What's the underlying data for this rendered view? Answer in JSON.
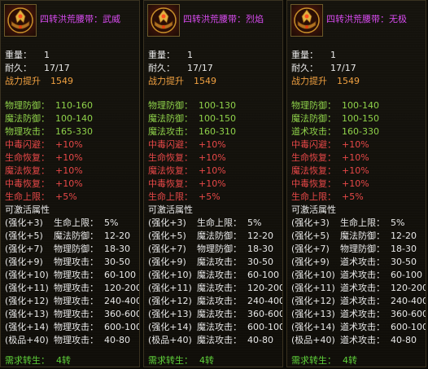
{
  "items": [
    {
      "name": "四转洪荒腰带：武威",
      "weight_label": "重量：",
      "weight": "1",
      "durability_label": "耐久：",
      "durability": "17/17",
      "power_label": "战力提升",
      "power": "1549",
      "attributes": [
        {
          "label": "物理防御：",
          "value": "110-160"
        },
        {
          "label": "魔法防御：",
          "value": "100-140"
        },
        {
          "label": "物理攻击：",
          "value": "165-330"
        }
      ],
      "bonuses": [
        {
          "label": "中毒闪避：",
          "value": "+10%"
        },
        {
          "label": "生命恢复：",
          "value": "+10%"
        },
        {
          "label": "魔法恢复：",
          "value": "+10%"
        },
        {
          "label": "中毒恢复：",
          "value": "+10%"
        },
        {
          "label": "生命上限：",
          "value": "+5%"
        }
      ],
      "activatable_title": "可激活属性",
      "enhancements": [
        {
          "level": "(强化+3)",
          "label": "生命上限：",
          "value": "5%"
        },
        {
          "level": "(强化+5)",
          "label": "魔法防御：",
          "value": "12-20"
        },
        {
          "level": "(强化+7)",
          "label": "物理防御：",
          "value": "18-30"
        },
        {
          "level": "(强化+9)",
          "label": "物理攻击：",
          "value": "30-50"
        },
        {
          "level": "(强化+10)",
          "label": "物理攻击：",
          "value": "60-100"
        },
        {
          "level": "(强化+11)",
          "label": "物理攻击：",
          "value": "120-200"
        },
        {
          "level": "(强化+12)",
          "label": "物理攻击：",
          "value": "240-400"
        },
        {
          "level": "(强化+13)",
          "label": "物理攻击：",
          "value": "360-600"
        },
        {
          "level": "(强化+14)",
          "label": "物理攻击：",
          "value": "600-1000"
        },
        {
          "level": "(极品+40)",
          "label": "物理攻击：",
          "value": "40-80"
        }
      ],
      "requirement_label": "需求转生：",
      "requirement": "4转"
    },
    {
      "name": "四转洪荒腰带：烈焰",
      "weight_label": "重量：",
      "weight": "1",
      "durability_label": "耐久：",
      "durability": "17/17",
      "power_label": "战力提升",
      "power": "1549",
      "attributes": [
        {
          "label": "物理防御：",
          "value": "100-130"
        },
        {
          "label": "魔法防御：",
          "value": "100-150"
        },
        {
          "label": "魔法攻击：",
          "value": "160-310"
        }
      ],
      "bonuses": [
        {
          "label": "中毒闪避：",
          "value": "+10%"
        },
        {
          "label": "生命恢复：",
          "value": "+10%"
        },
        {
          "label": "魔法恢复：",
          "value": "+10%"
        },
        {
          "label": "中毒恢复：",
          "value": "+10%"
        },
        {
          "label": "生命上限：",
          "value": "+5%"
        }
      ],
      "activatable_title": "可激活属性",
      "enhancements": [
        {
          "level": "(强化+3)",
          "label": "生命上限：",
          "value": "5%"
        },
        {
          "level": "(强化+5)",
          "label": "魔法防御：",
          "value": "12-20"
        },
        {
          "level": "(强化+7)",
          "label": "物理防御：",
          "value": "18-30"
        },
        {
          "level": "(强化+9)",
          "label": "魔法攻击：",
          "value": "30-50"
        },
        {
          "level": "(强化+10)",
          "label": "魔法攻击：",
          "value": "60-100"
        },
        {
          "level": "(强化+11)",
          "label": "魔法攻击：",
          "value": "120-200"
        },
        {
          "level": "(强化+12)",
          "label": "魔法攻击：",
          "value": "240-400"
        },
        {
          "level": "(强化+13)",
          "label": "魔法攻击：",
          "value": "360-600"
        },
        {
          "level": "(强化+14)",
          "label": "魔法攻击：",
          "value": "600-1000"
        },
        {
          "level": "(极品+40)",
          "label": "魔法攻击：",
          "value": "40-80"
        }
      ],
      "requirement_label": "需求转生：",
      "requirement": "4转"
    },
    {
      "name": "四转洪荒腰带：无极",
      "weight_label": "重量：",
      "weight": "1",
      "durability_label": "耐久：",
      "durability": "17/17",
      "power_label": "战力提升",
      "power": "1549",
      "attributes": [
        {
          "label": "物理防御：",
          "value": "100-140"
        },
        {
          "label": "魔法防御：",
          "value": "100-150"
        },
        {
          "label": "道术攻击：",
          "value": "160-330"
        }
      ],
      "bonuses": [
        {
          "label": "中毒闪避：",
          "value": "+10%"
        },
        {
          "label": "生命恢复：",
          "value": "+10%"
        },
        {
          "label": "魔法恢复：",
          "value": "+10%"
        },
        {
          "label": "中毒恢复：",
          "value": "+10%"
        },
        {
          "label": "生命上限：",
          "value": "+5%"
        }
      ],
      "activatable_title": "可激活属性",
      "enhancements": [
        {
          "level": "(强化+3)",
          "label": "生命上限：",
          "value": "5%"
        },
        {
          "level": "(强化+5)",
          "label": "魔法防御：",
          "value": "12-20"
        },
        {
          "level": "(强化+7)",
          "label": "物理防御：",
          "value": "18-30"
        },
        {
          "level": "(强化+9)",
          "label": "道术攻击：",
          "value": "30-50"
        },
        {
          "level": "(强化+10)",
          "label": "道术攻击：",
          "value": "60-100"
        },
        {
          "level": "(强化+11)",
          "label": "道术攻击：",
          "value": "120-200"
        },
        {
          "level": "(强化+12)",
          "label": "道术攻击：",
          "value": "240-400"
        },
        {
          "level": "(强化+13)",
          "label": "道术攻击：",
          "value": "360-600"
        },
        {
          "level": "(强化+14)",
          "label": "道术攻击：",
          "value": "600-1000"
        },
        {
          "level": "(极品+40)",
          "label": "道术攻击：",
          "value": "40-80"
        }
      ],
      "requirement_label": "需求转生：",
      "requirement": "4转"
    }
  ],
  "colors": {
    "title": "#d84bf0",
    "stat": "#e8e8e8",
    "power": "#f0a040",
    "attribute": "#8fd24a",
    "bonus": "#e84848",
    "requirement": "#5fd23a"
  },
  "icon": "belt-icon"
}
